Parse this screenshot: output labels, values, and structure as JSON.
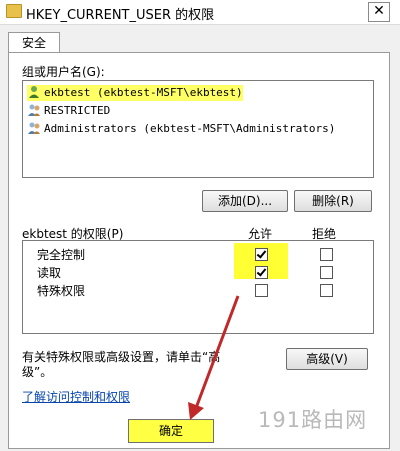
{
  "window": {
    "title": "HKEY_CURRENT_USER 的权限",
    "close_glyph": "✕"
  },
  "tab": {
    "label": "安全"
  },
  "users": {
    "label": "组或用户名(G):",
    "items": [
      {
        "name": "ekbtest (ekbtest-MSFT\\ekbtest)",
        "icon": "user-icon"
      },
      {
        "name": "RESTRICTED",
        "icon": "group-icon"
      },
      {
        "name": "Administrators (ekbtest-MSFT\\Administrators)",
        "icon": "group-icon"
      }
    ],
    "selected_index": 0
  },
  "buttons": {
    "add": "添加(D)...",
    "remove": "删除(R)",
    "advanced": "高级(V)",
    "ok": "确定"
  },
  "permissions": {
    "label": "ekbtest 的权限(P)",
    "allow_header": "允许",
    "deny_header": "拒绝",
    "rows": [
      {
        "name": "完全控制",
        "allow": true,
        "deny": false
      },
      {
        "name": "读取",
        "allow": true,
        "deny": false
      },
      {
        "name": "特殊权限",
        "allow": false,
        "deny": false
      }
    ]
  },
  "info": {
    "line1": "有关特殊权限或高级设置，请单击“高",
    "line2": "级”。"
  },
  "link": {
    "text": "了解访问控制和权限"
  },
  "watermark": {
    "text": "191路由网"
  },
  "colors": {
    "highlight": "#ffff33",
    "link": "#0645ad",
    "arrow": "#c0282a"
  }
}
